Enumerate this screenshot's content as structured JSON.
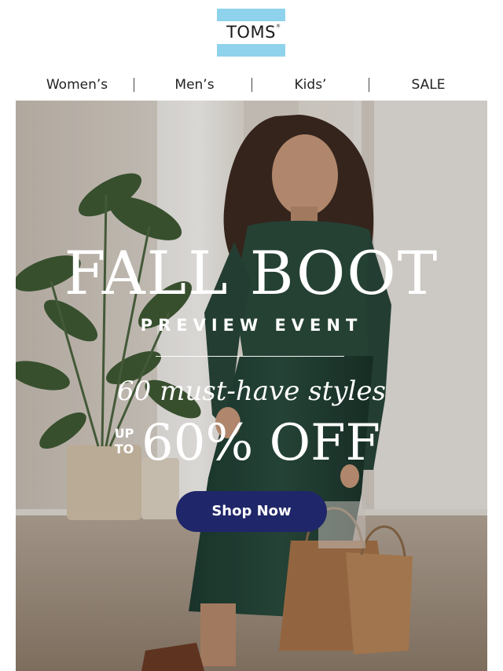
{
  "brand": {
    "logo_text": "TOMS",
    "logo_mark": "®",
    "logo_band_color": "#8fd2ec"
  },
  "nav": {
    "items": [
      {
        "label": "Women’s"
      },
      {
        "label": "Men’s"
      },
      {
        "label": "Kids’"
      },
      {
        "label": "SALE"
      }
    ]
  },
  "hero": {
    "headline": "FALL BOOT",
    "subheadline": "PREVIEW EVENT",
    "tagline": "60 must-have styles",
    "discount_prefix_line1": "UP",
    "discount_prefix_line2": "TO",
    "discount": "60% OFF",
    "cta_label": "Shop Now",
    "cta_color": "#1f2669"
  }
}
